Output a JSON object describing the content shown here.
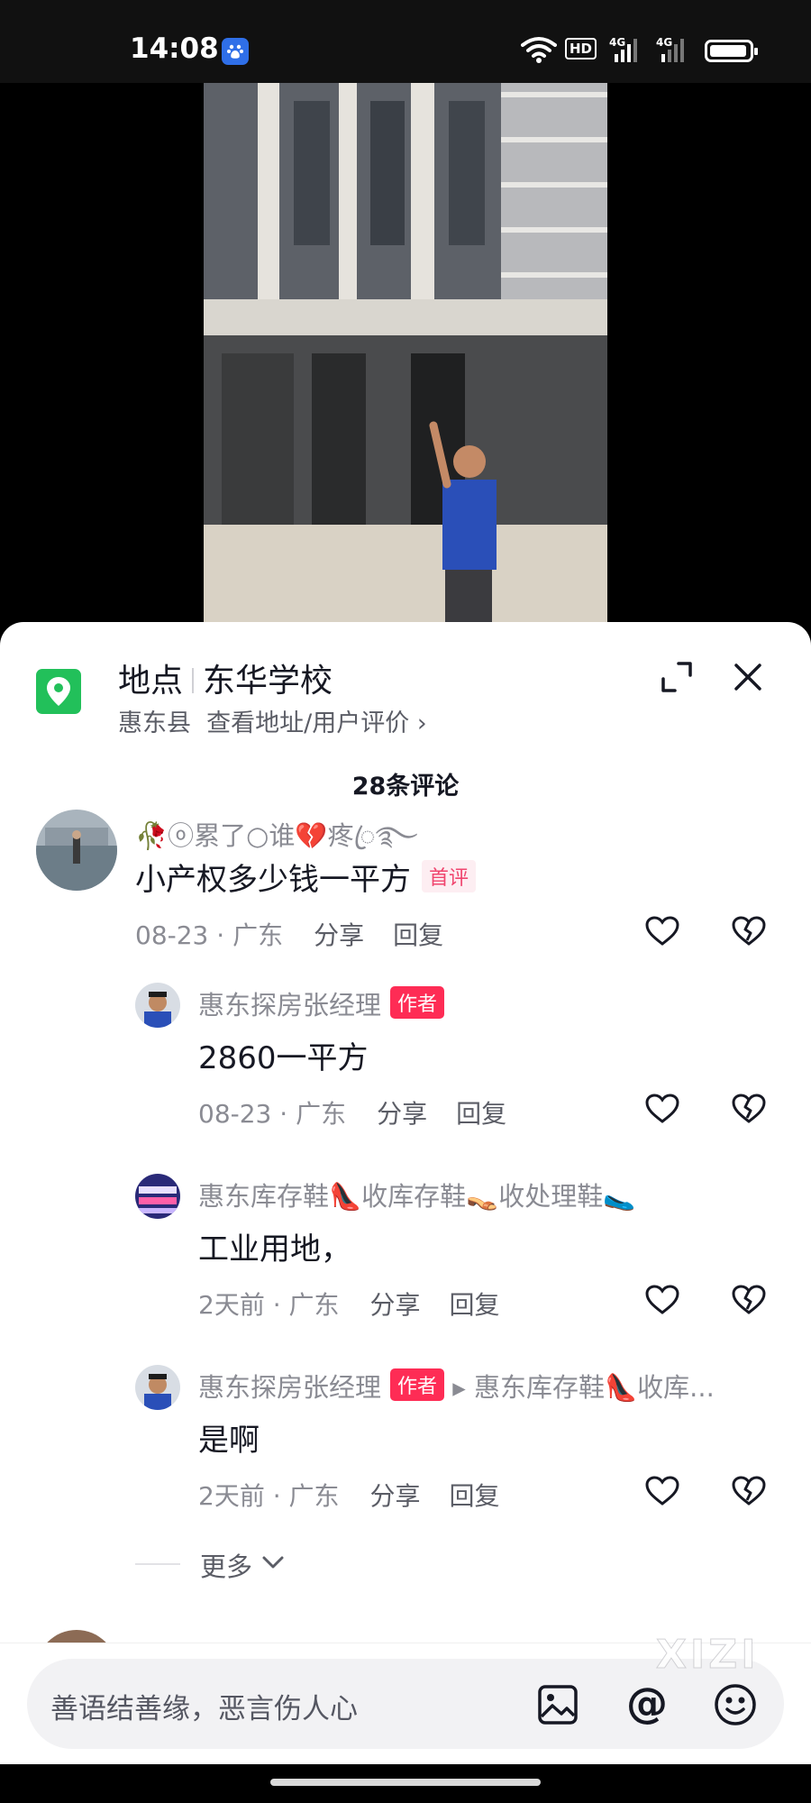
{
  "status_bar": {
    "time": "14:08",
    "hd_label": "HD",
    "signal1_label": "4G",
    "signal2_label": "4G"
  },
  "location": {
    "label": "地点",
    "name": "东华学校",
    "county": "惠东县",
    "link": "查看地址/用户评价 ›"
  },
  "comment_count": "28条评论",
  "comments": [
    {
      "nickname": "🥀ⓞ累了○谁💔疼ꦿ࿐",
      "text": "小产权多少钱一平方",
      "badge": "首评",
      "date": "08-23 · 广东",
      "share": "分享",
      "reply": "回复"
    },
    {
      "nickname": "惠东探房张经理",
      "badge": "作者",
      "text": "2860一平方",
      "date": "08-23 · 广东",
      "share": "分享",
      "reply": "回复"
    },
    {
      "nickname": "惠东库存鞋👠收库存鞋👡收处理鞋🥿",
      "text": "工业用地，",
      "date": "2天前 · 广东",
      "share": "分享",
      "reply": "回复"
    },
    {
      "nickname": "惠东探房张经理",
      "badge": "作者",
      "reply_to": "▸ 惠东库存鞋👠收库...",
      "text": "是啊",
      "date": "2天前 · 广东",
      "share": "分享",
      "reply": "回复"
    }
  ],
  "more_label": "更多",
  "input": {
    "placeholder": "善语结善缘，恶言伤人心",
    "at_label": "@"
  },
  "watermark": "XIZI",
  "colors": {
    "accent": "#fe2c55",
    "location_green": "#22c05a",
    "text_primary": "#161823",
    "text_secondary": "#8a8b93"
  }
}
